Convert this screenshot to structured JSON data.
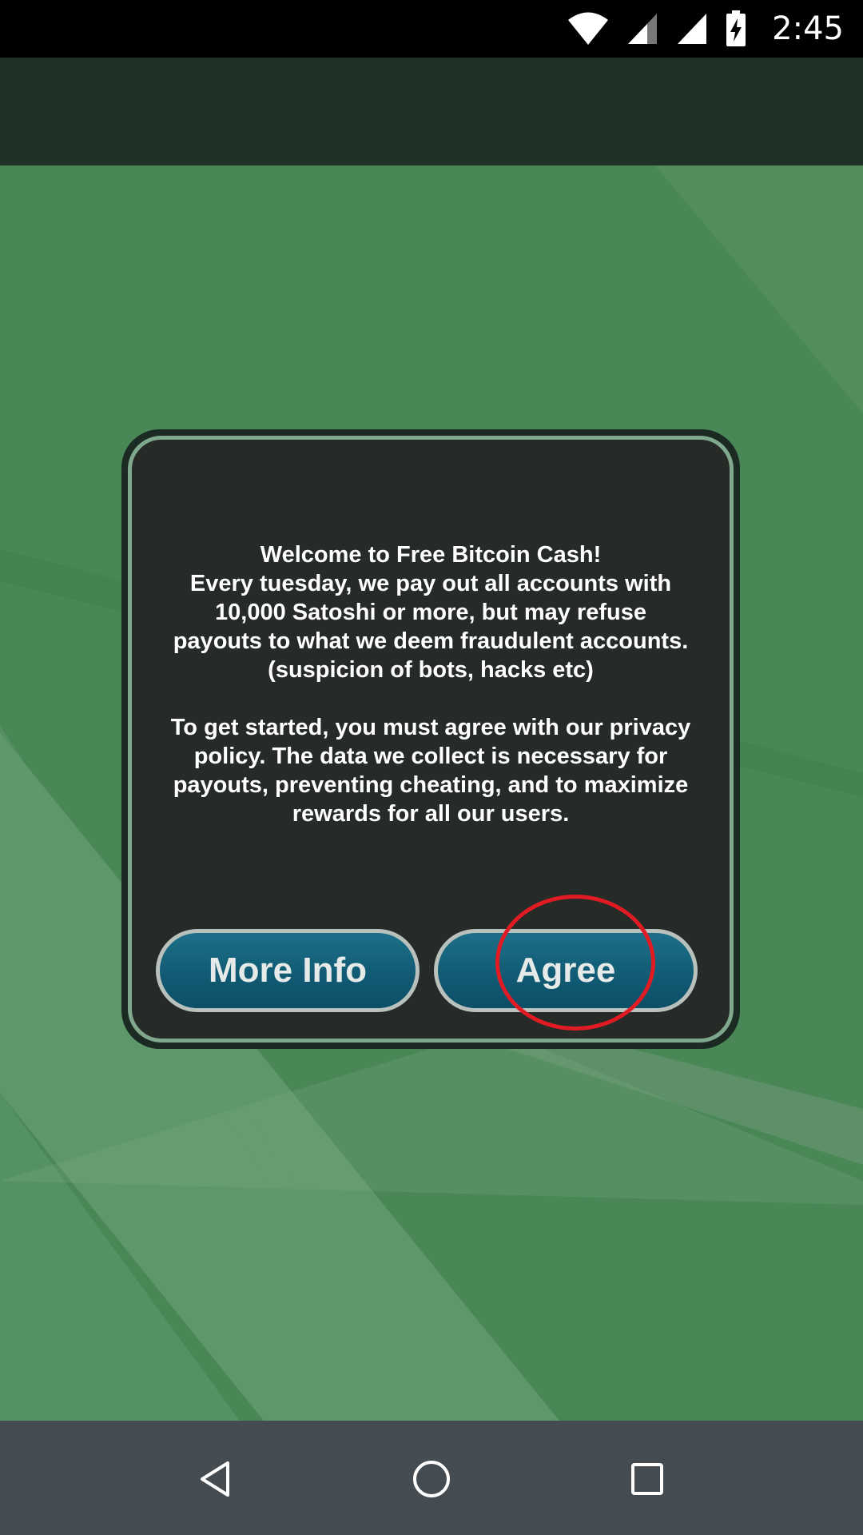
{
  "status_bar": {
    "time": "2:45",
    "icons": [
      "wifi-icon",
      "cell-signal-icon",
      "cell-signal-full-icon",
      "battery-charging-icon"
    ]
  },
  "dialog": {
    "line1": "Welcome to Free Bitcoin Cash!",
    "line2": "Every tuesday, we pay out all accounts with",
    "line3": "10,000 Satoshi or more, but may refuse",
    "line4": "payouts to what we deem fraudulent accounts.",
    "line5": "(suspicion of bots, hacks etc)",
    "line6": "To get started, you must agree with our privacy",
    "line7": "policy. The data we collect is necessary for",
    "line8": "payouts, preventing cheating, and to maximize",
    "line9": "rewards for all our users.",
    "more_info_label": "More Info",
    "agree_label": "Agree"
  },
  "nav_bar": {
    "icons": [
      "back-icon",
      "home-icon",
      "recents-icon"
    ]
  },
  "colors": {
    "background_green": "#4a8757",
    "header": "#1e3226",
    "button_blue": "#115b74",
    "highlight_red": "#e01b24",
    "nav_bar": "#444c52"
  }
}
